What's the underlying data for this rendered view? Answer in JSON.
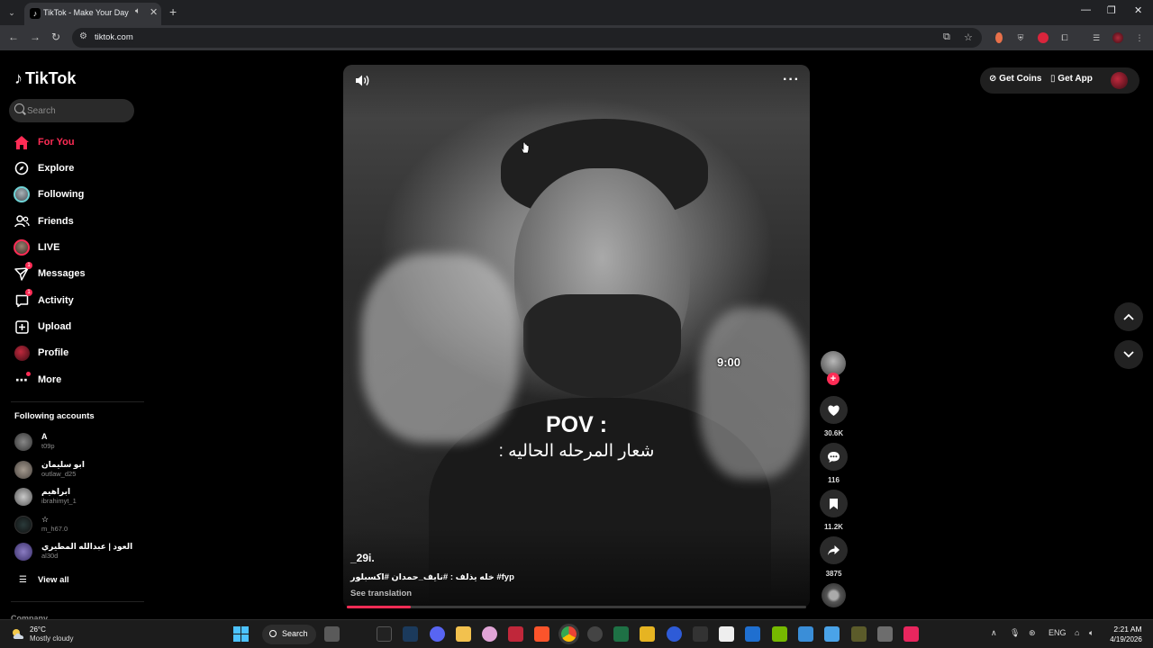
{
  "browser": {
    "tab_title": "TikTok - Make Your Day",
    "url": "tiktok.com"
  },
  "tiktok": {
    "brand": "TikTok",
    "search_placeholder": "Search",
    "nav": [
      {
        "label": "For You",
        "icon": "home-icon",
        "active": true
      },
      {
        "label": "Explore",
        "icon": "compass-icon"
      },
      {
        "label": "Following",
        "icon": "following-avatar-icon"
      },
      {
        "label": "Friends",
        "icon": "friends-icon"
      },
      {
        "label": "LIVE",
        "icon": "live-avatar-icon"
      },
      {
        "label": "Messages",
        "icon": "messages-icon",
        "badge": "1"
      },
      {
        "label": "Activity",
        "icon": "activity-icon",
        "badge": "1"
      },
      {
        "label": "Upload",
        "icon": "upload-icon"
      },
      {
        "label": "Profile",
        "icon": "profile-avatar-icon"
      },
      {
        "label": "More",
        "icon": "more-icon"
      }
    ],
    "following_title": "Following accounts",
    "accounts": [
      {
        "name": "A",
        "handle": "t09p"
      },
      {
        "name": "ابو سليمان",
        "handle": "outlaw_d25"
      },
      {
        "name": "ابراهيم",
        "handle": "ibrahimyt_1"
      },
      {
        "name": "☆",
        "handle": "m_h67.0"
      },
      {
        "name": "العود | عبدالله المطيري",
        "handle": "al30d"
      }
    ],
    "view_all": "View all",
    "company": "Company",
    "header": {
      "get_coins": "Get Coins",
      "get_app": "Get App"
    }
  },
  "video": {
    "overlay_time": "9:00",
    "overlay_pov": "POV :",
    "overlay_caption": "شعار المرحله الحاليه :",
    "author": "_29i.",
    "description": "خله يذلف : #نايف_حمدان #اكسبلور #fyp",
    "see_translation": "See translation",
    "progress": 0.14,
    "likes": "30.6K",
    "comments": "116",
    "saves": "11.2K",
    "shares": "3875"
  },
  "taskbar": {
    "temperature": "26°C",
    "condition": "Mostly cloudy",
    "search_label": "Search",
    "language": "ENG",
    "time": "2:21 AM",
    "date": "4/19/2026"
  }
}
